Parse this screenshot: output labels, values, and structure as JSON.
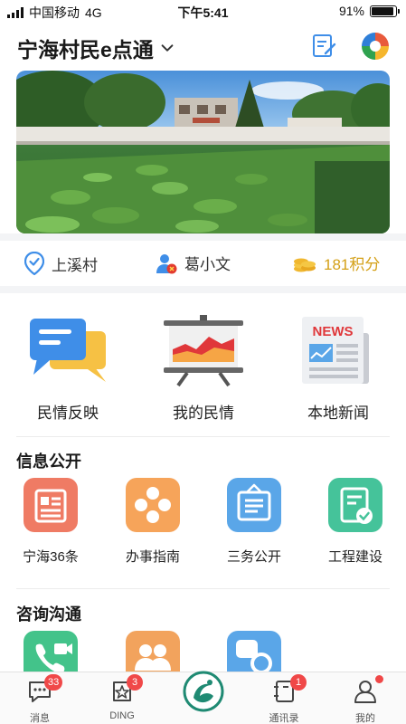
{
  "status_bar": {
    "carrier": "中国移动",
    "network": "4G",
    "time": "下午5:41",
    "battery_text": "91%",
    "battery_level": 0.91
  },
  "header": {
    "title": "宁海村民e点通"
  },
  "info_bar": {
    "village": "上溪村",
    "user_name": "葛小文",
    "points": "181积分"
  },
  "main_items": [
    {
      "label": "民情反映",
      "icon": "chat-bubbles-icon"
    },
    {
      "label": "我的民情",
      "icon": "presentation-board-icon"
    },
    {
      "label": "本地新闻",
      "icon": "newspaper-icon",
      "icon_text": "NEWS"
    }
  ],
  "sections": {
    "info_public": {
      "title": "信息公开",
      "items": [
        {
          "label": "宁海36条",
          "icon": "document-list-icon",
          "color": "#ef7b64"
        },
        {
          "label": "办事指南",
          "icon": "diamond-dots-icon",
          "color": "#f6a45a"
        },
        {
          "label": "三务公开",
          "icon": "notice-board-icon",
          "color": "#5aa6e8"
        },
        {
          "label": "工程建设",
          "icon": "check-document-icon",
          "color": "#45c39a"
        }
      ]
    },
    "consult": {
      "title": "咨询沟通",
      "items": [
        {
          "icon": "phone-video-icon",
          "color": "#43c38a"
        },
        {
          "icon": "group-people-icon",
          "color": "#f2a35d"
        },
        {
          "icon": "chat-exchange-icon",
          "color": "#5aa6e8"
        }
      ]
    }
  },
  "tab_bar": [
    {
      "label": "消息",
      "icon": "message-icon",
      "badge": "33"
    },
    {
      "label": "DING",
      "icon": "ding-icon",
      "badge": "3"
    },
    {
      "label": "",
      "icon": "app-logo-icon"
    },
    {
      "label": "通讯录",
      "icon": "contacts-icon",
      "badge": "1"
    },
    {
      "label": "我的",
      "icon": "profile-icon"
    }
  ],
  "colors": {
    "accent_blue": "#3f8ee8",
    "points_gold": "#d4a017",
    "badge_red": "#f04848"
  }
}
